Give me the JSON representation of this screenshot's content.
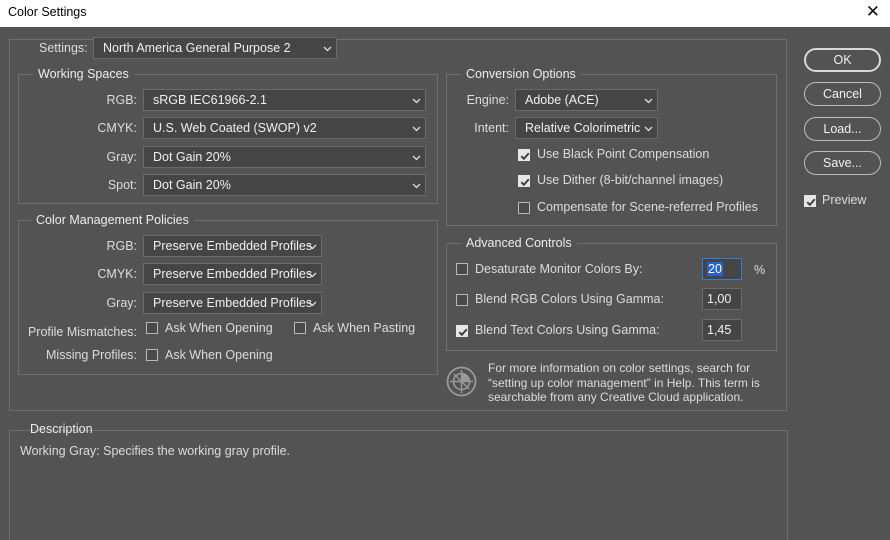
{
  "window": {
    "title": "Color Settings",
    "close_glyph": "✕"
  },
  "settings": {
    "label": "Settings:",
    "value": "North America General Purpose 2"
  },
  "working_spaces": {
    "title": "Working Spaces",
    "rgb": {
      "label": "RGB:",
      "value": "sRGB IEC61966-2.1"
    },
    "cmyk": {
      "label": "CMYK:",
      "value": "U.S. Web Coated (SWOP) v2"
    },
    "gray": {
      "label": "Gray:",
      "value": "Dot Gain 20%"
    },
    "spot": {
      "label": "Spot:",
      "value": "Dot Gain 20%"
    }
  },
  "policies": {
    "title": "Color Management Policies",
    "rgb": {
      "label": "RGB:",
      "value": "Preserve Embedded Profiles"
    },
    "cmyk": {
      "label": "CMYK:",
      "value": "Preserve Embedded Profiles"
    },
    "gray": {
      "label": "Gray:",
      "value": "Preserve Embedded Profiles"
    },
    "profile_mismatches": {
      "label": "Profile Mismatches:",
      "ask_opening": "Ask When Opening",
      "ask_pasting": "Ask When Pasting",
      "ask_opening_checked": false,
      "ask_pasting_checked": false
    },
    "missing_profiles": {
      "label": "Missing Profiles:",
      "ask_opening": "Ask When Opening",
      "ask_opening_checked": false
    }
  },
  "conversion": {
    "title": "Conversion Options",
    "engine": {
      "label": "Engine:",
      "value": "Adobe (ACE)"
    },
    "intent": {
      "label": "Intent:",
      "value": "Relative Colorimetric"
    },
    "black_point": {
      "label": "Use Black Point Compensation",
      "checked": true
    },
    "dither": {
      "label": "Use Dither (8-bit/channel images)",
      "checked": true
    },
    "scene_referred": {
      "label": "Compensate for Scene-referred Profiles",
      "checked": false
    }
  },
  "advanced": {
    "title": "Advanced Controls",
    "desaturate": {
      "label": "Desaturate Monitor Colors By:",
      "value": "20",
      "unit": "%",
      "checked": false
    },
    "blend_rgb": {
      "label": "Blend RGB Colors Using Gamma:",
      "value": "1,00",
      "checked": false
    },
    "blend_text": {
      "label": "Blend Text Colors Using Gamma:",
      "value": "1,45",
      "checked": true
    }
  },
  "info_text": {
    "line1": "For more information on color settings, search for",
    "line2": "“setting up color management” in Help. This term is",
    "line3": "searchable from any Creative Cloud application."
  },
  "buttons": {
    "ok": "OK",
    "cancel": "Cancel",
    "load": "Load...",
    "save": "Save..."
  },
  "preview": {
    "label": "Preview",
    "checked": true
  },
  "description": {
    "title": "Description",
    "text": "Working Gray:  Specifies the working gray profile."
  }
}
